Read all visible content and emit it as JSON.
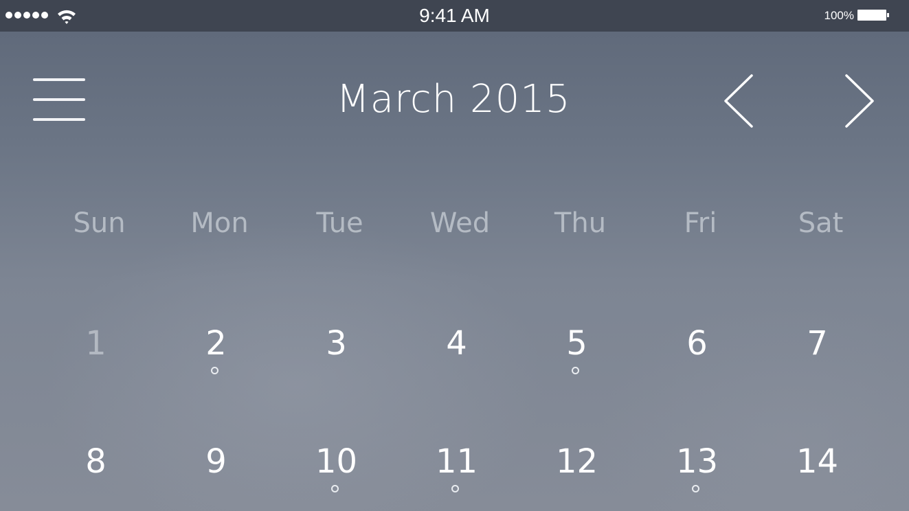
{
  "status_bar": {
    "time": "9:41 AM",
    "battery_percent": "100%",
    "signal_bars": 5,
    "icons": [
      "signal-dots-icon",
      "wifi-icon",
      "battery-icon"
    ]
  },
  "header": {
    "title": "March 2015",
    "menu_icon": "hamburger-menu-icon",
    "prev_icon": "chevron-left-icon",
    "next_icon": "chevron-right-icon"
  },
  "calendar": {
    "weekdays": [
      "Sun",
      "Mon",
      "Tue",
      "Wed",
      "Thu",
      "Fri",
      "Sat"
    ],
    "weeks": [
      [
        {
          "day": "1",
          "event": false,
          "muted": true
        },
        {
          "day": "2",
          "event": true,
          "muted": false
        },
        {
          "day": "3",
          "event": false,
          "muted": false
        },
        {
          "day": "4",
          "event": false,
          "muted": false
        },
        {
          "day": "5",
          "event": true,
          "muted": false
        },
        {
          "day": "6",
          "event": false,
          "muted": false
        },
        {
          "day": "7",
          "event": false,
          "muted": false
        }
      ],
      [
        {
          "day": "8",
          "event": false,
          "muted": false
        },
        {
          "day": "9",
          "event": false,
          "muted": false
        },
        {
          "day": "10",
          "event": true,
          "muted": false
        },
        {
          "day": "11",
          "event": true,
          "muted": false
        },
        {
          "day": "12",
          "event": false,
          "muted": false
        },
        {
          "day": "13",
          "event": true,
          "muted": false
        },
        {
          "day": "14",
          "event": false,
          "muted": false
        }
      ]
    ]
  },
  "colors": {
    "status_bar_bg": "#3f4551",
    "background_top": "#5d6778",
    "background_bottom": "#868c98",
    "text": "#ffffff"
  }
}
